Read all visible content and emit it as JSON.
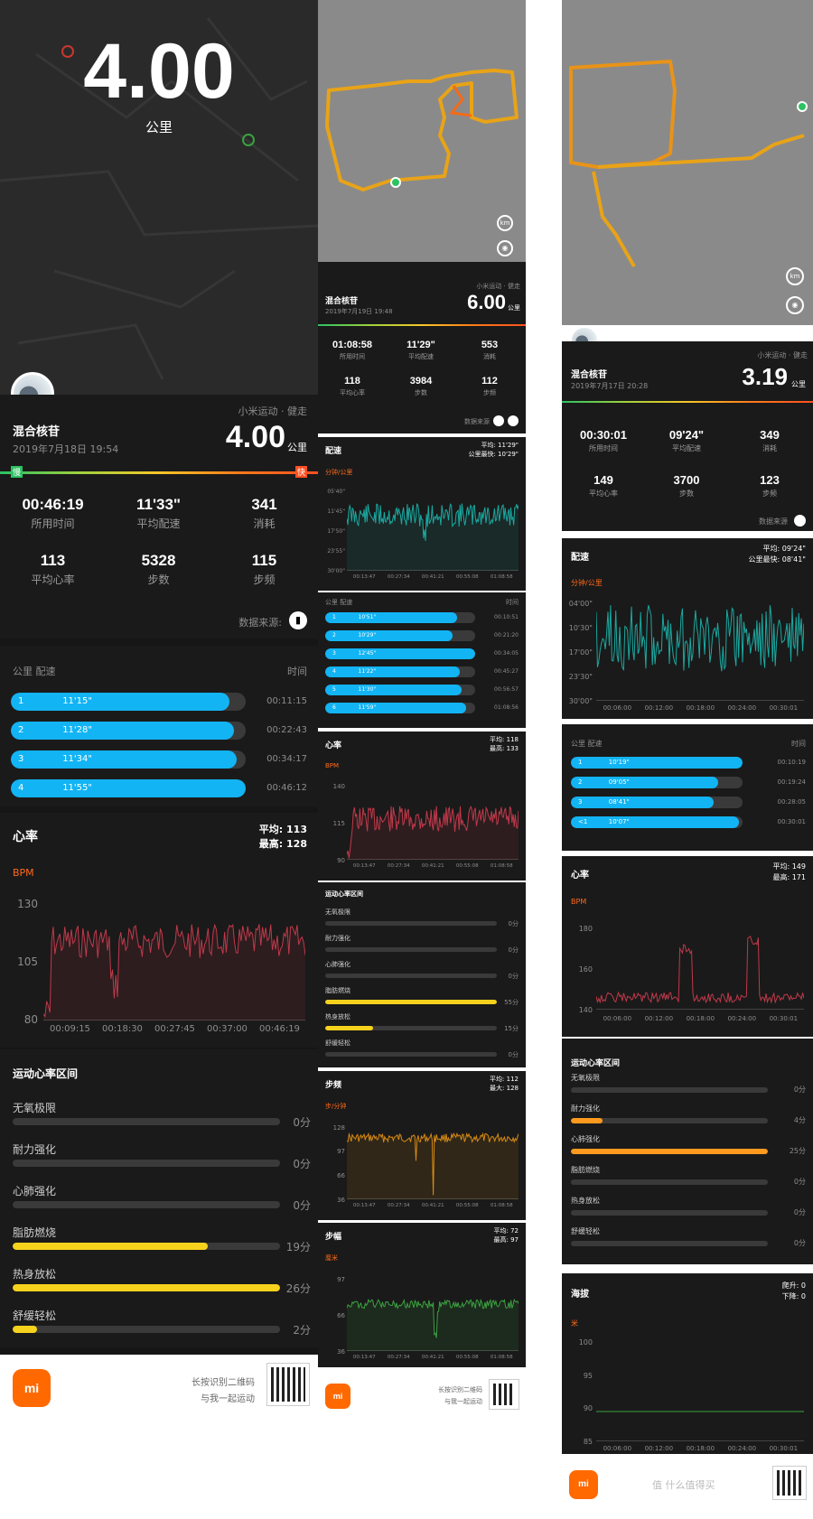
{
  "colors": {
    "accent": "#12b4f4",
    "zone_yellow": "#f7d21c",
    "zone_orange": "#ff9a1f",
    "heart": "#c0394a",
    "cadence": "#d78a14",
    "stride": "#3aa23f",
    "pace": "#1aa8a0"
  },
  "left": {
    "hero_distance": "4.00",
    "hero_unit": "公里",
    "title": "混合核苷",
    "source_tag": "小米运动 · 健走",
    "datetime": "2019年7月18日 19:54",
    "distance": "4.00",
    "distance_unit": "公里",
    "slow": "慢",
    "fast": "快",
    "stats": [
      {
        "value": "00:46:19",
        "label": "所用时间"
      },
      {
        "value": "11'33\"",
        "label": "平均配速"
      },
      {
        "value": "341",
        "label": "消耗"
      },
      {
        "value": "113",
        "label": "平均心率"
      },
      {
        "value": "5328",
        "label": "步数"
      },
      {
        "value": "115",
        "label": "步频"
      }
    ],
    "data_source_label": "数据来源:",
    "splits_header": "公里  配速",
    "splits_time_header": "时间",
    "splits": [
      {
        "km": "1",
        "pace": "11'15\"",
        "time": "00:11:15",
        "fill": 0.93
      },
      {
        "km": "2",
        "pace": "11'28\"",
        "time": "00:22:43",
        "fill": 0.95
      },
      {
        "km": "3",
        "pace": "11'34\"",
        "time": "00:34:17",
        "fill": 0.96
      },
      {
        "km": "4",
        "pace": "11'55\"",
        "time": "00:46:12",
        "fill": 1.0
      }
    ],
    "hr_title": "心率",
    "hr_avg": "平均: 113",
    "hr_max": "最高: 128",
    "hr_unit": "BPM",
    "hr_y": [
      "130",
      "105",
      "80"
    ],
    "hr_x": [
      "00:09:15",
      "00:18:30",
      "00:27:45",
      "00:37:00",
      "00:46:19"
    ],
    "zones_title": "运动心率区间",
    "zones": [
      {
        "label": "无氧极限",
        "value": "0分",
        "fill": 0
      },
      {
        "label": "耐力强化",
        "value": "0分",
        "fill": 0
      },
      {
        "label": "心肺强化",
        "value": "0分",
        "fill": 0
      },
      {
        "label": "脂肪燃烧",
        "value": "19分",
        "fill": 0.73
      },
      {
        "label": "热身放松",
        "value": "26分",
        "fill": 1.0
      },
      {
        "label": "舒缓轻松",
        "value": "2分",
        "fill": 0.09
      }
    ],
    "footer_line1": "长按识别二维码",
    "footer_line2": "与我一起运动",
    "logo": "mi"
  },
  "mid": {
    "title": "混合核苷",
    "source_tag": "小米运动 · 健走",
    "datetime": "2019年7月19日 19:48",
    "distance": "6.00",
    "distance_unit": "公里",
    "stats": [
      {
        "value": "01:08:58",
        "label": "所用时间"
      },
      {
        "value": "11'29\"",
        "label": "平均配速"
      },
      {
        "value": "553",
        "label": "消耗"
      },
      {
        "value": "118",
        "label": "平均心率"
      },
      {
        "value": "3984",
        "label": "步数"
      },
      {
        "value": "112",
        "label": "步频"
      }
    ],
    "data_source_label": "数据来源",
    "pace_title": "配速",
    "pace_avg": "平均: 11'29\"",
    "pace_best": "公里最快: 10'29\"",
    "pace_unit": "分钟/公里",
    "pace_y": [
      "05'40\"",
      "11'45\"",
      "17'50\"",
      "23'55\"",
      "30'00\""
    ],
    "x": [
      "00:13:47",
      "00:27:34",
      "00:41:21",
      "00:55:08",
      "01:08:58"
    ],
    "splits_header": "公里  配速",
    "splits_time_header": "时间",
    "splits": [
      {
        "km": "1",
        "pace": "10'51\"",
        "time": "00:10:51",
        "fill": 0.88
      },
      {
        "km": "2",
        "pace": "10'29\"",
        "time": "00:21:20",
        "fill": 0.85
      },
      {
        "km": "3",
        "pace": "12'45\"",
        "time": "00:34:05",
        "fill": 1.0
      },
      {
        "km": "4",
        "pace": "11'22\"",
        "time": "00:45:27",
        "fill": 0.9
      },
      {
        "km": "5",
        "pace": "11'30\"",
        "time": "00:56:57",
        "fill": 0.91
      },
      {
        "km": "6",
        "pace": "11'59\"",
        "time": "01:08:56",
        "fill": 0.94
      }
    ],
    "hr_title": "心率",
    "hr_avg": "平均: 118",
    "hr_max": "最高: 133",
    "hr_unit": "BPM",
    "hr_y": [
      "140",
      "115",
      "90"
    ],
    "zones_title": "运动心率区间",
    "zones": [
      {
        "label": "无氧极限",
        "value": "0分",
        "fill": 0
      },
      {
        "label": "耐力强化",
        "value": "0分",
        "fill": 0
      },
      {
        "label": "心肺强化",
        "value": "0分",
        "fill": 0
      },
      {
        "label": "脂肪燃烧",
        "value": "55分",
        "fill": 1.0
      },
      {
        "label": "热身放松",
        "value": "15分",
        "fill": 0.28
      },
      {
        "label": "舒缓轻松",
        "value": "0分",
        "fill": 0
      }
    ],
    "cad_title": "步频",
    "cad_avg": "平均: 112",
    "cad_max": "最大: 128",
    "cad_unit": "步/分钟",
    "cad_y": [
      "128",
      "97",
      "66",
      "36"
    ],
    "stride_title": "步幅",
    "stride_avg": "平均: 72",
    "stride_max": "最高: 97",
    "stride_unit": "厘米",
    "stride_y": [
      "97",
      "66",
      "36"
    ],
    "footer_line1": "长按识别二维码",
    "footer_line2": "与我一起运动",
    "logo": "mi"
  },
  "right": {
    "title": "混合核苷",
    "source_tag": "小米运动 · 健走",
    "datetime": "2019年7月17日 20:28",
    "distance": "3.19",
    "distance_unit": "公里",
    "stats": [
      {
        "value": "00:30:01",
        "label": "所用时间"
      },
      {
        "value": "09'24\"",
        "label": "平均配速"
      },
      {
        "value": "349",
        "label": "消耗"
      },
      {
        "value": "149",
        "label": "平均心率"
      },
      {
        "value": "3700",
        "label": "步数"
      },
      {
        "value": "123",
        "label": "步频"
      }
    ],
    "data_source_label": "数据来源",
    "pace_title": "配速",
    "pace_avg": "平均: 09'24\"",
    "pace_best": "公里最快: 08'41\"",
    "pace_unit": "分钟/公里",
    "pace_y": [
      "04'00\"",
      "10'30\"",
      "17'00\"",
      "23'30\"",
      "30'00\""
    ],
    "x": [
      "00:06:00",
      "00:12:00",
      "00:18:00",
      "00:24:00",
      "00:30:01"
    ],
    "splits_header": "公里  配速",
    "splits_time_header": "时间",
    "splits": [
      {
        "km": "1",
        "pace": "10'19\"",
        "time": "00:10:19",
        "fill": 1.0
      },
      {
        "km": "2",
        "pace": "09'05\"",
        "time": "00:19:24",
        "fill": 0.86
      },
      {
        "km": "3",
        "pace": "08'41\"",
        "time": "00:28:05",
        "fill": 0.83
      },
      {
        "km": "<1",
        "pace": "10'07\"",
        "time": "00:30:01",
        "fill": 0.98
      }
    ],
    "hr_title": "心率",
    "hr_avg": "平均: 149",
    "hr_max": "最高: 171",
    "hr_unit": "BPM",
    "hr_y": [
      "180",
      "160",
      "140"
    ],
    "zones_title": "运动心率区间",
    "zones": [
      {
        "label": "无氧极限",
        "value": "0分",
        "fill": 0
      },
      {
        "label": "耐力强化",
        "value": "4分",
        "fill": 0.16
      },
      {
        "label": "心肺强化",
        "value": "25分",
        "fill": 1.0
      },
      {
        "label": "脂肪燃烧",
        "value": "0分",
        "fill": 0
      },
      {
        "label": "热身放松",
        "value": "0分",
        "fill": 0
      },
      {
        "label": "舒缓轻松",
        "value": "0分",
        "fill": 0
      }
    ],
    "alt_title": "海拔",
    "alt_up": "爬升: 0",
    "alt_down": "下降: 0",
    "alt_unit": "米",
    "alt_y": [
      "100",
      "95",
      "90",
      "85"
    ],
    "logo": "mi",
    "watermark": "值 什么值得买"
  }
}
